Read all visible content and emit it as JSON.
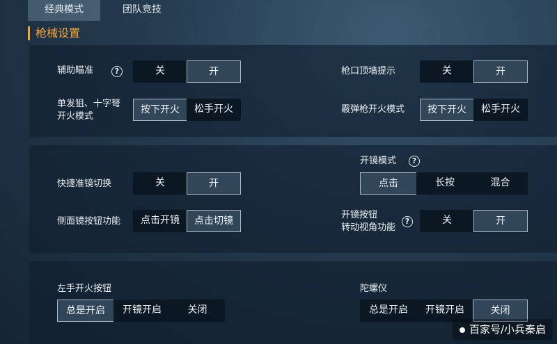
{
  "tabs": [
    "经典模式",
    "团队竞技"
  ],
  "section_title": "枪械设置",
  "help_glyph": "?",
  "panel1": {
    "aim_assist": {
      "label": "辅助瞄准",
      "options": [
        "关",
        "开"
      ],
      "selected": "开"
    },
    "muzzle_wall": {
      "label": "枪口顶墙提示",
      "options": [
        "关",
        "开"
      ],
      "selected": "开"
    },
    "sniper_fire": {
      "label": "单发狙、十字弩\n开火模式",
      "options": [
        "按下开火",
        "松手开火"
      ],
      "selected": "按下开火"
    },
    "shotgun_fire": {
      "label": "霰弹枪开火模式",
      "options": [
        "按下开火",
        "松手开火"
      ],
      "selected": "按下开火"
    }
  },
  "panel2": {
    "quick_scope": {
      "label": "快捷准镜切换",
      "options": [
        "关",
        "开"
      ],
      "selected": "开"
    },
    "side_scope": {
      "label": "侧面镜按钮功能",
      "options": [
        "点击开镜",
        "点击切镜"
      ],
      "selected": "点击切镜"
    },
    "scope_mode": {
      "label": "开镜模式",
      "options": [
        "点击",
        "长按",
        "混合"
      ],
      "selected": "点击"
    },
    "scope_turn": {
      "label": "开镜按钮\n转动视角功能",
      "options": [
        "关",
        "开"
      ],
      "selected": "开"
    }
  },
  "panel3": {
    "left_fire": {
      "label": "左手开火按钮",
      "options": [
        "总是开启",
        "开镜开启",
        "关闭"
      ],
      "selected": "总是开启"
    },
    "gyro": {
      "label": "陀螺仪",
      "options": [
        "总是开启",
        "开镜开启",
        "关闭"
      ],
      "selected": "关闭"
    }
  },
  "watermark": "百家号/小兵秦启"
}
